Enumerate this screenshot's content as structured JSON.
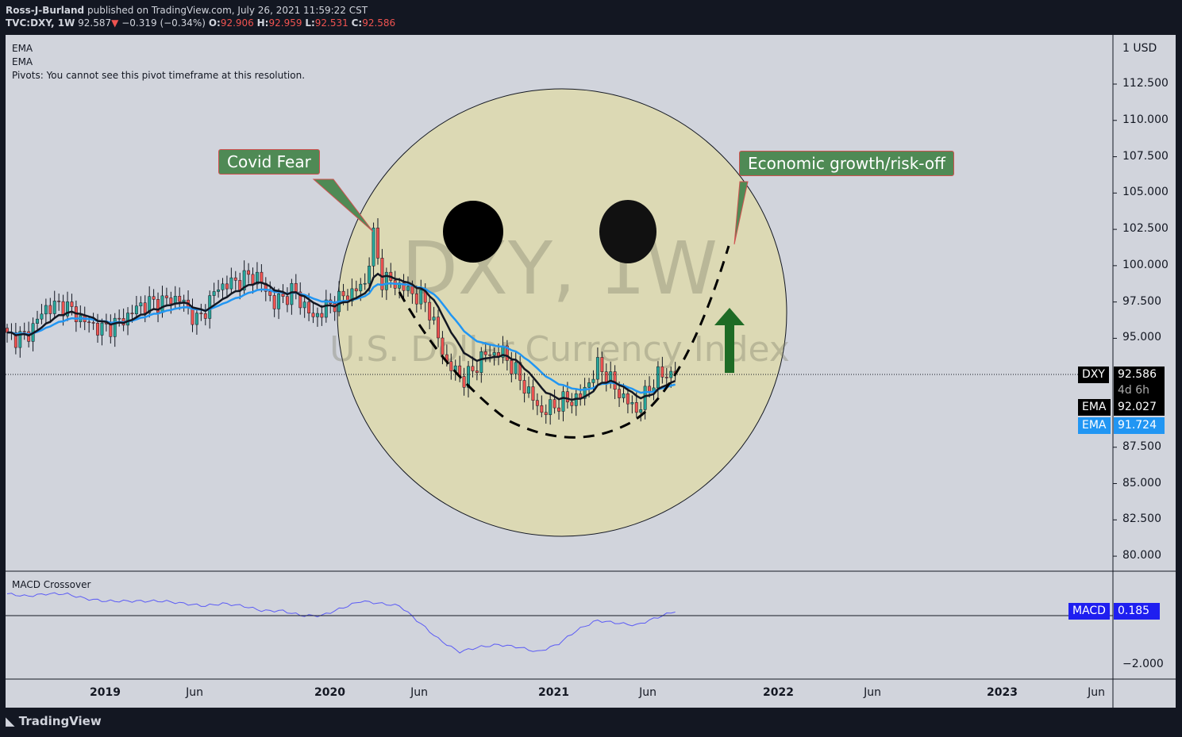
{
  "header": {
    "author": "Ross-J-Burland",
    "published": "published on TradingView.com, July 26, 2021 11:59:22 CST",
    "symbol": "TVC:DXY, 1W",
    "last": "92.587",
    "change": "−0.319 (−0.34%)",
    "o": "92.906",
    "h": "92.959",
    "l": "92.531",
    "c": "92.586"
  },
  "legend": [
    "EMA",
    "EMA",
    "Pivots: You cannot see this pivot timeframe at this resolution."
  ],
  "watermark": {
    "title": "DXY, 1W",
    "subtitle": "U.S. Dollar Currency Index"
  },
  "annotations": {
    "left": "Covid Fear",
    "right": "Economic growth/risk-off"
  },
  "price_axis": {
    "unit": "1 USD",
    "ticks": [
      "112.500",
      "110.000",
      "107.500",
      "105.000",
      "102.500",
      "100.000",
      "97.500",
      "95.000",
      "87.500",
      "85.000",
      "82.500",
      "80.000"
    ]
  },
  "tags": {
    "dxy_label": "DXY",
    "dxy_value": "92.586",
    "countdown": "4d 6h",
    "ema1_label": "EMA",
    "ema1_value": "92.027",
    "ema2_label": "EMA",
    "ema2_value": "91.724",
    "macd_label": "MACD",
    "macd_value": "0.185"
  },
  "macd_panel": {
    "title": "MACD Crossover",
    "tick": "−2.000"
  },
  "time_axis": [
    "2019",
    "Jun",
    "2020",
    "Jun",
    "2021",
    "Jun",
    "2022",
    "Jun",
    "2023",
    "Jun"
  ],
  "footer": "TradingView",
  "colors": {
    "up": "#26a69a",
    "down": "#ef5350",
    "ema_fast": "#131722",
    "ema_slow": "#2196f3",
    "macd": "#5b5bf5",
    "face": "#dcd9b4"
  },
  "chart_data": {
    "type": "candlestick",
    "title": "TVC:DXY, 1W",
    "x_start": "2018-08",
    "x_unit": "month",
    "monthly_close": [
      95.1,
      95.1,
      97.1,
      97.3,
      96.2,
      95.6,
      96.2,
      97.3,
      97.5,
      97.8,
      96.1,
      98.5,
      98.9,
      99.4,
      97.4,
      98.3,
      96.4,
      97.4,
      98.1,
      99.0,
      99.0,
      98.3,
      97.4,
      93.3,
      92.1,
      93.9,
      94.0,
      91.9,
      89.9,
      90.6,
      90.9,
      93.2,
      91.3,
      90.0,
      92.4,
      92.6
    ],
    "macd_monthly": [
      0.9,
      0.8,
      0.9,
      0.9,
      0.7,
      0.6,
      0.6,
      0.6,
      0.6,
      0.5,
      0.4,
      0.5,
      0.4,
      0.2,
      0.2,
      0.0,
      0.0,
      0.3,
      0.6,
      0.5,
      0.4,
      -0.3,
      -1.0,
      -1.5,
      -1.3,
      -1.2,
      -1.3,
      -1.5,
      -1.2,
      -0.6,
      -0.2,
      -0.3,
      -0.4,
      -0.1,
      0.185
    ],
    "ylim": [
      78.5,
      114
    ],
    "macd_ylim": [
      -2.7,
      1.4
    ]
  }
}
